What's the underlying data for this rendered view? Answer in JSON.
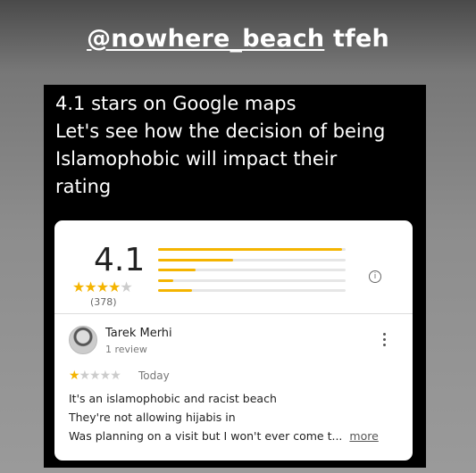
{
  "story": {
    "mention_handle": "@nowhere_beach",
    "mention_suffix": "tfeh",
    "caption_lines": [
      "4.1 stars on Google maps",
      "Let's see how the decision of being",
      "Islamophobic will impact their",
      "rating"
    ]
  },
  "rating_card": {
    "average": "4.1",
    "stars_filled": 4,
    "stars_total": 5,
    "count": "(378)",
    "distribution": [
      0.98,
      0.4,
      0.2,
      0.08,
      0.18
    ],
    "accent_color": "#f4b400",
    "info_icon": "info-icon"
  },
  "review": {
    "author": "Tarek Merhi",
    "author_meta": "1 review",
    "stars_filled": 1,
    "stars_total": 5,
    "date": "Today",
    "lines": [
      "It's an islamophobic and racist beach",
      "They're not allowing hijabis in",
      "Was planning on a visit but I won't ever come t..."
    ],
    "more_label": "more",
    "menu_icon": "more-vert-icon"
  }
}
